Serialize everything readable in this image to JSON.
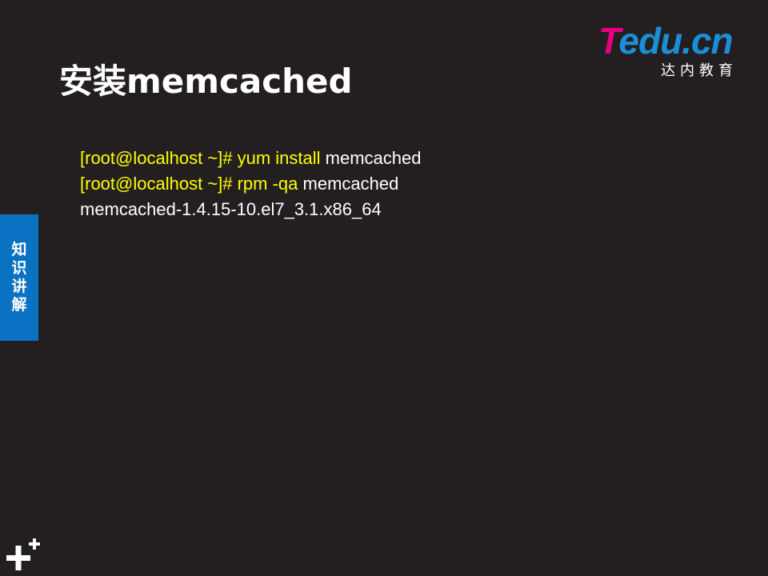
{
  "slide": {
    "title": "安装memcached",
    "side_tab_label": "知识讲解"
  },
  "logo": {
    "brand_first": "T",
    "brand_rest": "edu.cn",
    "subtitle": "达内教育"
  },
  "terminal": {
    "lines": [
      {
        "prompt": "[root@localhost ~]# ",
        "command": "yum install",
        "arg": " memcached"
      },
      {
        "prompt": "[root@localhost ~]# ",
        "command": "rpm -qa",
        "arg": " memcached"
      },
      {
        "output": "memcached-1.4.15-10.el7_3.1.x86_64"
      }
    ]
  },
  "icons": {
    "corner": "plus-icon"
  },
  "colors": {
    "background": "#231f20",
    "accent_blue": "#0a72c2",
    "prompt_yellow": "#ffff00",
    "logo_magenta": "#e5007f",
    "logo_blue": "#1a8fd6"
  }
}
